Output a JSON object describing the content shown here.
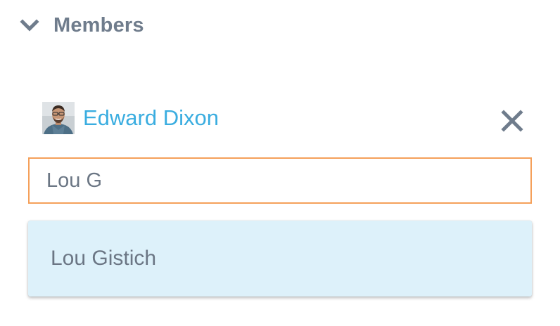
{
  "members_section": {
    "title": "Members",
    "expanded": true,
    "toggle_icon": "chevron-down-icon"
  },
  "members": [
    {
      "name": "Edward Dixon",
      "avatar_icon": "avatar-photo",
      "remove_icon": "close-icon"
    }
  ],
  "search": {
    "value": "Lou G"
  },
  "suggestions": [
    {
      "label": "Lou Gistich",
      "highlighted": true
    }
  ],
  "colors": {
    "header_text": "#6f7c8c",
    "link": "#3aade0",
    "input_focus_border": "#f5a05a",
    "suggestion_bg": "#ddf1fa",
    "body_text": "#6b7684"
  }
}
